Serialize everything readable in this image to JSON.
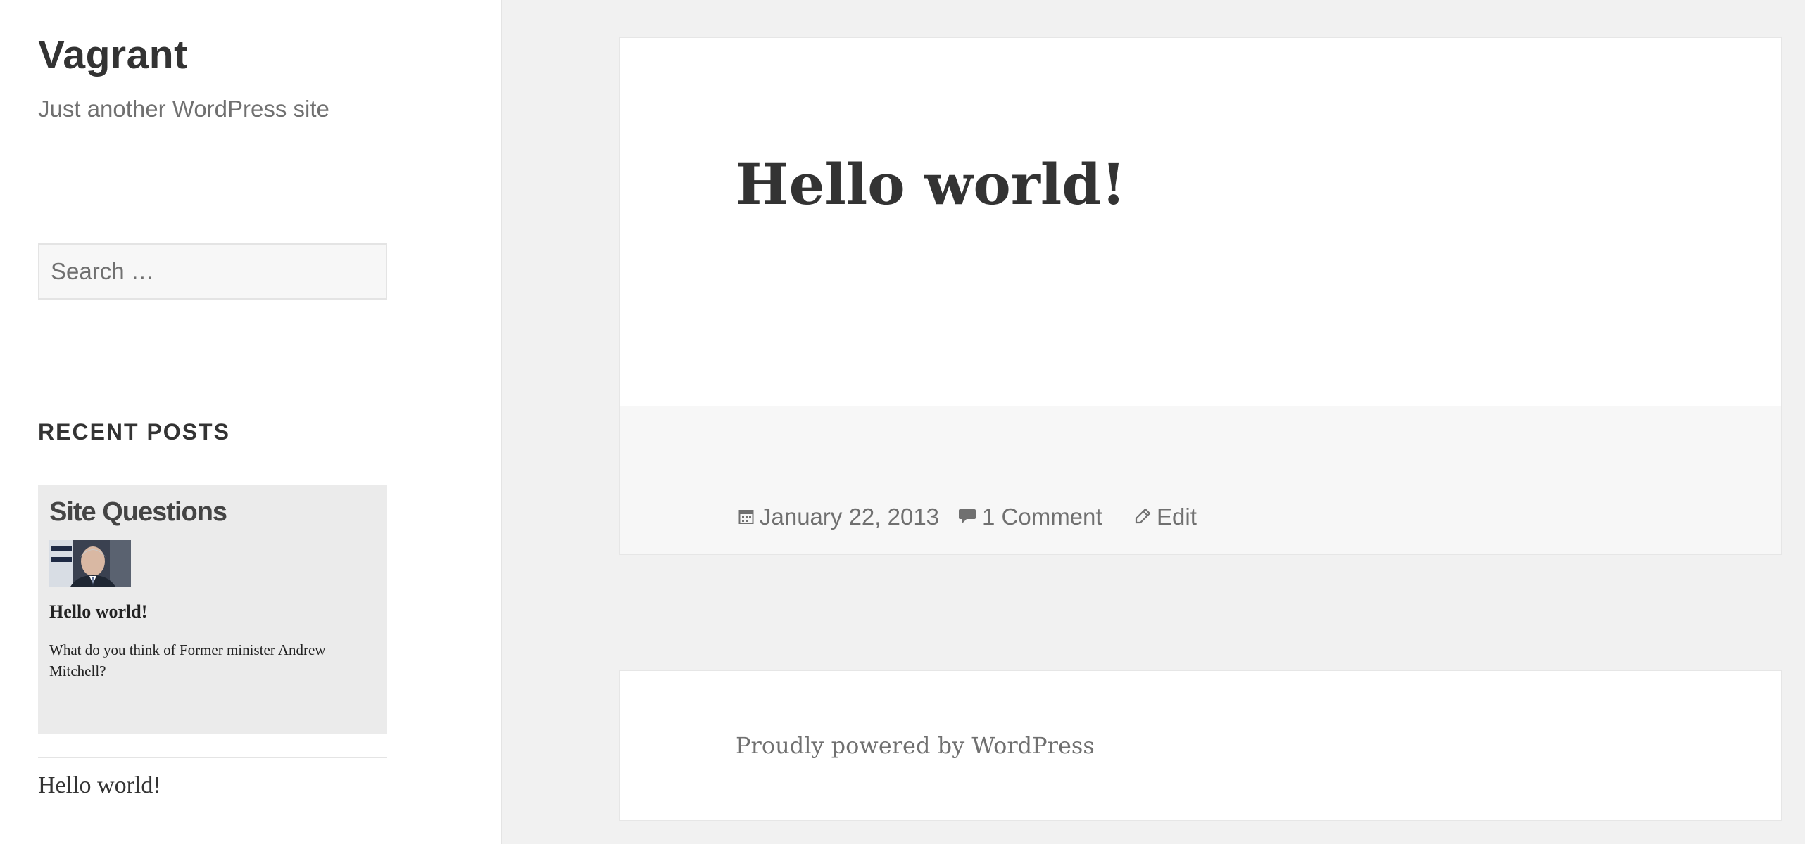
{
  "site": {
    "title": "Vagrant",
    "description": "Just another WordPress site"
  },
  "search": {
    "placeholder": "Search …"
  },
  "sidebar": {
    "widget_title": "RECENT POSTS",
    "featured": {
      "heading": "Site Questions",
      "thumbnail": "photo-of-man-in-suit",
      "post_title": "Hello world!",
      "excerpt": "What do you think of Former minister Andrew Mitchell?"
    },
    "recent_posts": [
      {
        "label": "Hello world!"
      }
    ]
  },
  "article": {
    "title": "Hello world!",
    "meta": {
      "date": "January 22, 2013",
      "comments": "1 Comment",
      "edit": "Edit"
    },
    "icons": {
      "date": "calendar-icon",
      "comments": "comment-bubble-icon",
      "edit": "pencil-icon"
    }
  },
  "footer": {
    "credit": "Proudly powered by WordPress"
  },
  "colors": {
    "page_background": "#f1f1f1",
    "sidebar_background": "#ffffff",
    "text_primary": "#333333",
    "text_secondary": "#707070",
    "entry_footer_background": "#f7f7f7",
    "featured_box_background": "#ebebeb"
  }
}
